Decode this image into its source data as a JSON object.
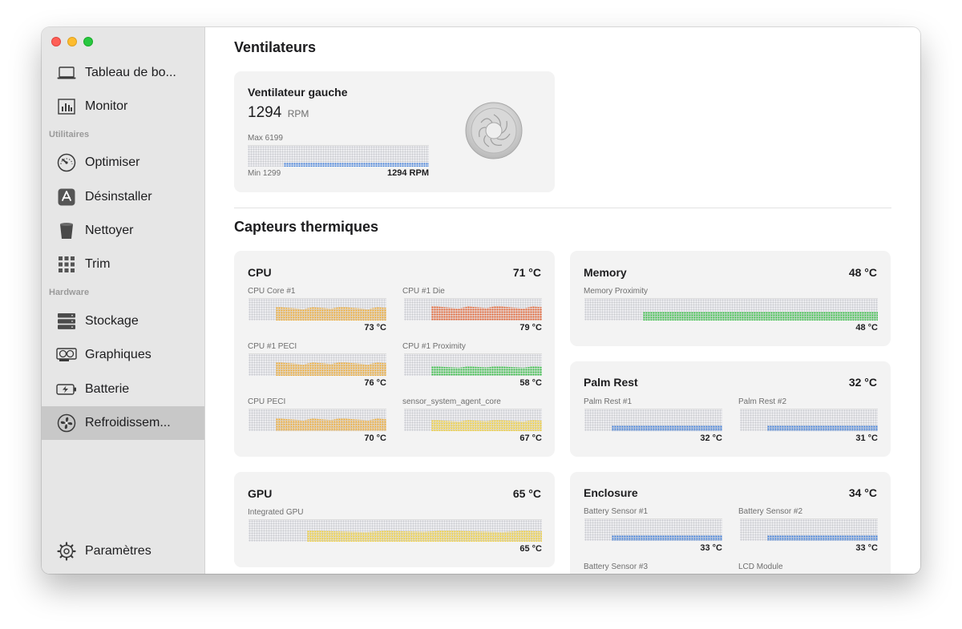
{
  "window": {
    "controls": [
      "close",
      "minimize",
      "zoom"
    ]
  },
  "sidebar": {
    "items": [
      {
        "label": "Tableau de bo...",
        "icon": "laptop-icon"
      },
      {
        "label": "Monitor",
        "icon": "chart-icon"
      },
      {
        "label": "Optimiser",
        "icon": "speedometer-icon"
      },
      {
        "label": "Désinstaller",
        "icon": "app-store-icon"
      },
      {
        "label": "Nettoyer",
        "icon": "trash-icon"
      },
      {
        "label": "Trim",
        "icon": "grid-icon"
      },
      {
        "label": "Stockage",
        "icon": "storage-icon"
      },
      {
        "label": "Graphiques",
        "icon": "gpu-icon"
      },
      {
        "label": "Batterie",
        "icon": "battery-icon"
      },
      {
        "label": "Refroidissem...",
        "icon": "fan-icon",
        "active": true
      },
      {
        "label": "Paramètres",
        "icon": "gear-icon"
      }
    ],
    "sections": {
      "utilities": "Utilitaires",
      "hardware": "Hardware"
    }
  },
  "fans": {
    "heading": "Ventilateurs",
    "card": {
      "title": "Ventilateur gauche",
      "rpm": "1294",
      "rpm_unit": "RPM",
      "max_label": "Max 6199",
      "min_label": "Min 1299",
      "current_label": "1294 RPM",
      "level": 0.19,
      "color": "#3d7dd8"
    }
  },
  "thermal": {
    "heading": "Capteurs thermiques",
    "cpu": {
      "title": "CPU",
      "temp": "71 °C",
      "sensors": [
        {
          "label": "CPU Core #1",
          "value": "73 °C",
          "color": "#f0a829",
          "level": 0.62
        },
        {
          "label": "CPU #1 Die",
          "value": "79 °C",
          "color": "#e8622e",
          "level": 0.68
        },
        {
          "label": "CPU #1 PECI",
          "value": "76 °C",
          "color": "#f0a829",
          "level": 0.62
        },
        {
          "label": "CPU #1 Proximity",
          "value": "58 °C",
          "color": "#34c042",
          "level": 0.45
        },
        {
          "label": "CPU PECI",
          "value": "70 °C",
          "color": "#f0a829",
          "level": 0.6
        },
        {
          "label": "sensor_system_agent_core",
          "value": "67 °C",
          "color": "#f3d032",
          "level": 0.52
        }
      ]
    },
    "memory": {
      "title": "Memory",
      "temp": "48 °C",
      "sensors": [
        {
          "label": "Memory Proximity",
          "value": "48 °C",
          "color": "#34c042",
          "level": 0.42
        }
      ]
    },
    "palm_rest": {
      "title": "Palm Rest",
      "temp": "32 °C",
      "sensors": [
        {
          "label": "Palm Rest #1",
          "value": "32 °C",
          "color": "#3d7dd8",
          "level": 0.25
        },
        {
          "label": "Palm Rest #2",
          "value": "31 °C",
          "color": "#3d7dd8",
          "level": 0.25
        }
      ]
    },
    "gpu": {
      "title": "GPU",
      "temp": "65 °C",
      "sensors": [
        {
          "label": "Integrated GPU",
          "value": "65 °C",
          "color": "#f3d032",
          "level": 0.52
        }
      ]
    },
    "enclosure": {
      "title": "Enclosure",
      "temp": "34 °C",
      "sensors": [
        {
          "label": "Battery Sensor #1",
          "value": "33 °C",
          "color": "#3d7dd8",
          "level": 0.25
        },
        {
          "label": "Battery Sensor #2",
          "value": "33 °C",
          "color": "#3d7dd8",
          "level": 0.25
        },
        {
          "label": "Battery Sensor #3",
          "value": "",
          "color": "#3d7dd8",
          "level": 0
        },
        {
          "label": "LCD Module",
          "value": "",
          "color": "#3d7dd8",
          "level": 0
        }
      ]
    }
  }
}
